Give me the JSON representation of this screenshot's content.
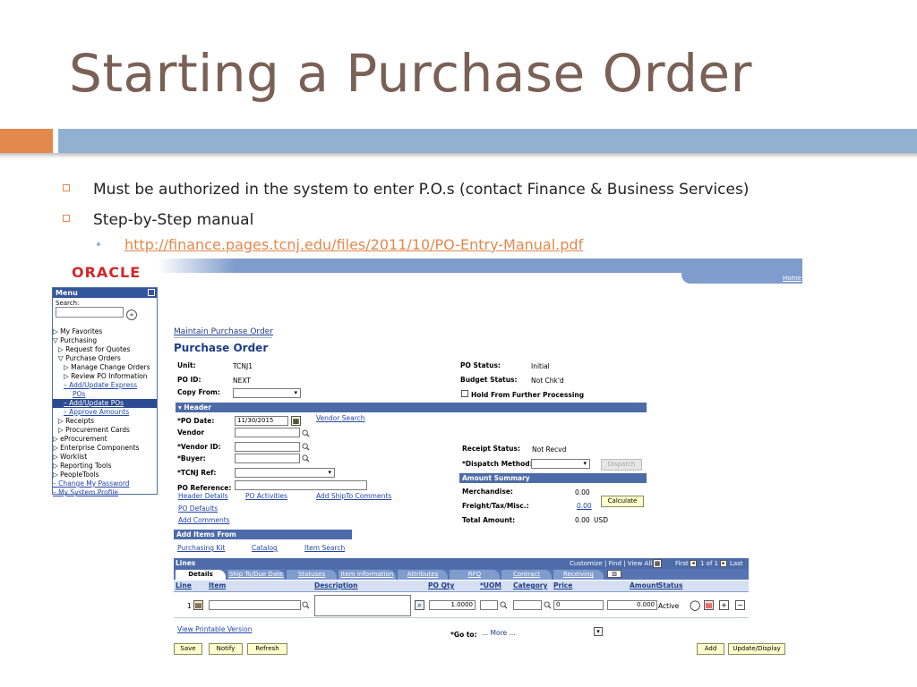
{
  "slide": {
    "title": "Starting  a Purchase Order",
    "bullets": [
      "Must be authorized in the system to enter P.O.s (contact Finance & Business Services)",
      "Step-by-Step manual"
    ],
    "link": "http://finance.pages.tcnj.edu/files/2011/10/PO-Entry-Manual.pdf",
    "colors": {
      "title": "#7a6055",
      "accent": "#e3884b",
      "band": "#92b1d0"
    }
  },
  "app": {
    "logo": "ORACLE",
    "home": "Home",
    "menu": {
      "title": "Menu",
      "search_label": "Search:",
      "items": [
        "▷ My Favorites",
        "▽ Purchasing",
        "  ▷ Request for Quotes",
        "  ▽ Purchase Orders",
        "     ▷ Manage Change Orders",
        "     ▷ Review PO Information",
        "     – Add/Update Express",
        "        POs",
        "     – Add/Update POs",
        "     – Approve Amounts",
        "  ▷ Receipts",
        "  ▷ Procurement Cards",
        "▷ eProcurement",
        "▷ Enterprise Components",
        "▷ Worklist",
        "▷ Reporting Tools",
        "▷ PeopleTools",
        "– Change My Password",
        "– My System Profile"
      ]
    },
    "breadcrumb": "Maintain Purchase Order",
    "page_title": "Purchase Order",
    "fields": {
      "unit_label": "Unit:",
      "unit_value": "TCNJ1",
      "poid_label": "PO ID:",
      "poid_value": "NEXT",
      "copy_label": "Copy From:",
      "status_label": "PO Status:",
      "status_value": "Initial",
      "budget_label": "Budget Status:",
      "budget_value": "Not Chk'd",
      "hold_label": "Hold From Further Processing"
    },
    "header": {
      "section": "Header",
      "podate_label": "*PO Date:",
      "podate_value": "11/30/2015",
      "vendor_search": "Vendor Search",
      "vendor_label": "Vendor",
      "vendor_id_label": "*Vendor ID:",
      "buyer_label": "*Buyer:",
      "tcnj_ref_label": "*TCNJ Ref:",
      "po_ref_label": "PO Reference:",
      "receipt_status_label": "Receipt Status:",
      "receipt_status_value": "Not Recvd",
      "dispatch_label": "*Dispatch Method:",
      "dispatch_button": "Dispatch",
      "links": [
        "Header Details",
        "PO Activities",
        "Add ShipTo Comments",
        "PO Defaults",
        "Add Comments"
      ]
    },
    "amount_summary": {
      "section": "Amount Summary",
      "merch_label": "Merchandise:",
      "merch_value": "0.00",
      "freight_label": "Freight/Tax/Misc.:",
      "freight_value": "0.00",
      "total_label": "Total Amount:",
      "total_value": "0.00",
      "currency": "USD",
      "calculate": "Calculate"
    },
    "add_items": {
      "section": "Add Items From",
      "links": [
        "Purchasing Kit",
        "Catalog",
        "Item Search"
      ]
    },
    "lines": {
      "title": "Lines",
      "nav": "Customize | Find | View All |",
      "first": "First",
      "count": "1 of 1",
      "last": "Last",
      "tabs": [
        "Details",
        "Ship To/Due Date",
        "Statuses",
        "Item Information",
        "Attributes",
        "RFQ",
        "Contract",
        "Receiving"
      ],
      "columns": [
        "Line",
        "Item",
        "Description",
        "PO Qty",
        "*UOM",
        "Category",
        "Price",
        "Amount",
        "Status"
      ],
      "row": {
        "line": "1",
        "qty": "1.0000",
        "price": "0",
        "amount": "0.000",
        "status": "Active"
      }
    },
    "footer": {
      "printable": "View Printable Version",
      "goto_label": "*Go to:",
      "goto_value": "... More ...",
      "buttons": [
        "Save",
        "Notify",
        "Refresh"
      ],
      "right_buttons": [
        "Add",
        "Update/Display"
      ]
    }
  }
}
